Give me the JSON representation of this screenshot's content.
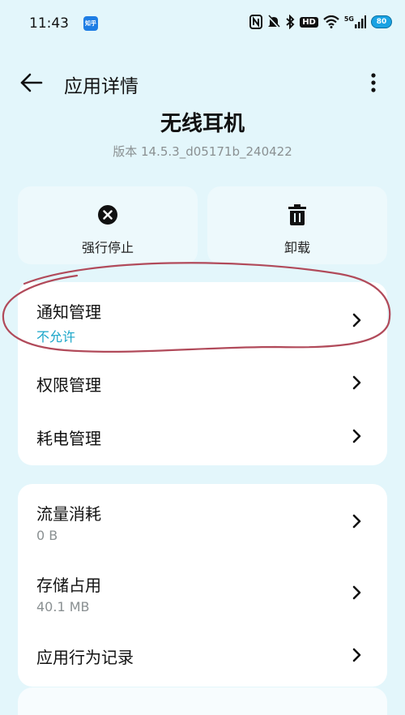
{
  "status_bar": {
    "time": "11:43",
    "notification_app": "知乎",
    "hd": "HD",
    "network": "5G",
    "battery": "80",
    "icons": [
      "nfc-icon",
      "mute-icon",
      "bluetooth-icon",
      "hd-icon",
      "wifi-icon",
      "signal-5g-icon",
      "battery-icon"
    ]
  },
  "header": {
    "title": "应用详情",
    "back_icon": "arrow-left-icon",
    "more_icon": "more-vert-icon"
  },
  "app": {
    "name": "无线耳机",
    "version": "版本 14.5.3_d05171b_240422"
  },
  "actions": {
    "force_stop": {
      "label": "强行停止",
      "icon": "close-circle-icon"
    },
    "uninstall": {
      "label": "卸载",
      "icon": "trash-icon"
    }
  },
  "settings_group_1": {
    "items": [
      {
        "title": "通知管理",
        "subtitle": "不允许"
      },
      {
        "title": "权限管理"
      },
      {
        "title": "耗电管理"
      }
    ]
  },
  "settings_group_2": {
    "items": [
      {
        "title": "流量消耗",
        "subtitle": "0 B"
      },
      {
        "title": "存储占用",
        "subtitle": "40.1 MB"
      },
      {
        "title": "应用行为记录"
      }
    ]
  },
  "colors": {
    "background": "#e3f6fb",
    "card": "#ffffff",
    "accent": "#1aa6c9",
    "annotation": "#b14a5a",
    "secondary_text": "#8a9092"
  }
}
